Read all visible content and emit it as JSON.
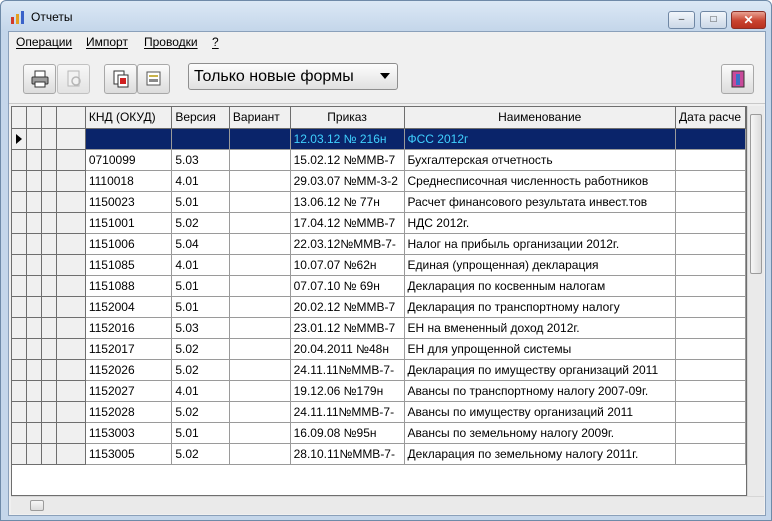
{
  "window": {
    "title": "Отчеты"
  },
  "menu": [
    {
      "label": "Операции"
    },
    {
      "label": "Импорт"
    },
    {
      "label": "Проводки"
    },
    {
      "label": "?"
    }
  ],
  "toolbar": {
    "buttons": [
      {
        "icon": "printer-icon",
        "enabled": true
      },
      {
        "icon": "print-preview-icon",
        "enabled": false
      },
      {
        "icon": "document-red-icon",
        "enabled": true
      },
      {
        "icon": "stamp-icon",
        "enabled": true
      },
      {
        "icon": "exit-door-icon",
        "enabled": true
      }
    ],
    "filter": {
      "value": "Только новые формы"
    }
  },
  "grid": {
    "columns": [
      "КНД (ОКУД)",
      "Версия",
      "Вариант",
      "Приказ",
      "Наименование",
      "Дата расче"
    ],
    "rows": [
      {
        "knd": "",
        "version": "",
        "variant": "",
        "order": "12.03.12 № 216н",
        "name": "ФСС 2012г",
        "date": "",
        "selected": true
      },
      {
        "knd": "0710099",
        "version": "5.03",
        "variant": "",
        "order": "15.02.12 №ММВ-7",
        "name": "Бухгалтерская отчетность",
        "date": ""
      },
      {
        "knd": "1110018",
        "version": "4.01",
        "variant": "",
        "order": "29.03.07 №ММ-3-2",
        "name": "Среднесписочная численность работников",
        "date": ""
      },
      {
        "knd": "1150023",
        "version": "5.01",
        "variant": "",
        "order": "13.06.12 № 77н",
        "name": "Расчет финансового результата инвест.тов",
        "date": ""
      },
      {
        "knd": "1151001",
        "version": "5.02",
        "variant": "",
        "order": "17.04.12 №ММВ-7",
        "name": "НДС 2012г.",
        "date": ""
      },
      {
        "knd": "1151006",
        "version": "5.04",
        "variant": "",
        "order": "22.03.12№ММВ-7-",
        "name": "Налог на прибыль организации 2012г.",
        "date": ""
      },
      {
        "knd": "1151085",
        "version": "4.01",
        "variant": "",
        "order": "10.07.07 №62н",
        "name": "Единая (упрощенная) декларация",
        "date": ""
      },
      {
        "knd": "1151088",
        "version": "5.01",
        "variant": "",
        "order": "07.07.10 № 69н",
        "name": "Декларация по косвенным налогам",
        "date": ""
      },
      {
        "knd": "1152004",
        "version": "5.01",
        "variant": "",
        "order": "20.02.12 №ММВ-7",
        "name": "Декларация по транспортному налогу",
        "date": ""
      },
      {
        "knd": "1152016",
        "version": "5.03",
        "variant": "",
        "order": "23.01.12 №ММВ-7",
        "name": "ЕН на вмененный доход 2012г.",
        "date": ""
      },
      {
        "knd": "1152017",
        "version": "5.02",
        "variant": "",
        "order": "20.04.2011 №48н",
        "name": "ЕН для упрощенной системы",
        "date": ""
      },
      {
        "knd": "1152026",
        "version": "5.02",
        "variant": "",
        "order": "24.11.11№ММВ-7-",
        "name": "Декларация по имуществу организаций 2011",
        "date": ""
      },
      {
        "knd": "1152027",
        "version": "4.01",
        "variant": "",
        "order": "19.12.06 №179н",
        "name": "Авансы по транспортному налогу 2007-09г.",
        "date": ""
      },
      {
        "knd": "1152028",
        "version": "5.02",
        "variant": "",
        "order": "24.11.11№ММВ-7-",
        "name": "Авансы по имуществу организаций 2011",
        "date": ""
      },
      {
        "knd": "1153003",
        "version": "5.01",
        "variant": "",
        "order": "16.09.08 №95н",
        "name": "Авансы по земельному налогу 2009г.",
        "date": ""
      },
      {
        "knd": "1153005",
        "version": "5.02",
        "variant": "",
        "order": "28.10.11№ММВ-7-",
        "name": "Декларация по земельному налогу 2011г.",
        "date": ""
      }
    ]
  }
}
